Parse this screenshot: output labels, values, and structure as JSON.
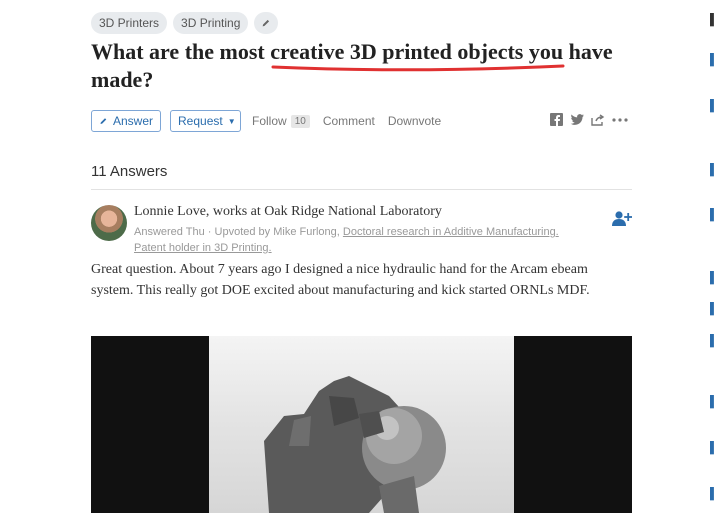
{
  "question": {
    "topics": [
      "3D Printers",
      "3D Printing"
    ],
    "edit_icon": "pencil-icon",
    "title": "What are the most creative 3D printed objects you have made?",
    "highlight_color": "#e03131"
  },
  "actions": {
    "answer_label": "Answer",
    "request_label": "Request",
    "follow_label": "Follow",
    "follow_count": "10",
    "comment_label": "Comment",
    "downvote_label": "Downvote",
    "share_icons": [
      "facebook-icon",
      "twitter-icon",
      "share-icon",
      "more-icon"
    ]
  },
  "answers_header": "11 Answers",
  "answer": {
    "author": "Lonnie Love, works at Oak Ridge National Laboratory",
    "answered": "Answered Thu",
    "upvoted_prefix": " · Upvoted by Mike Furlong, ",
    "upvoter_credential_1": "Doctoral research in Additive Manufacturing.",
    "upvoter_credential_2": "Patent holder in 3D Printing.",
    "text": "Great question. About 7 years ago I designed a nice hydraulic hand for the Arcam ebeam system. This really got DOE excited about manufacturing and kick started ORNLs MDF.",
    "image_icon": "robotic-hand-image"
  },
  "colors": {
    "accent": "#2b6dad",
    "chip_bg": "#e8ebee"
  }
}
